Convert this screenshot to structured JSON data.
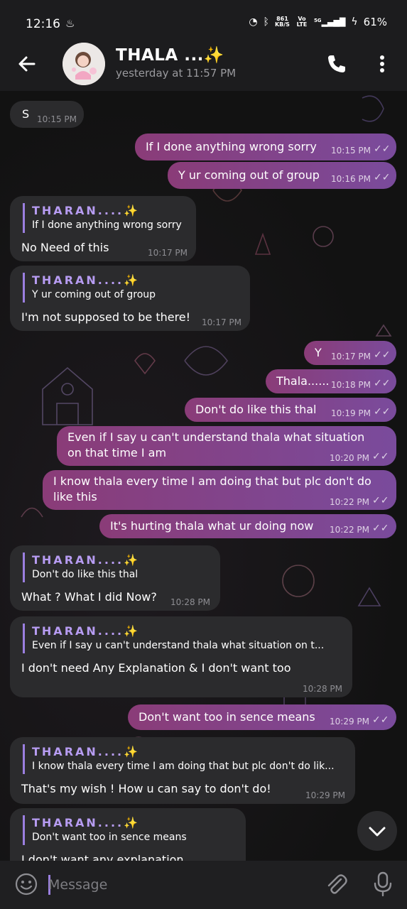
{
  "status_bar": {
    "time": "12:16",
    "net_speed": "861",
    "net_unit": "KB/S",
    "volte": "Vo LTE",
    "signal": "5G",
    "battery": "61%"
  },
  "header": {
    "title": "THALA ...✨",
    "subtitle": "yesterday at 11:57 PM"
  },
  "colors": {
    "incoming": "#2b2b2d",
    "outgoing_start": "#8a3c78",
    "outgoing_end": "#7a4b9c",
    "reply_accent": "#9b7fe0"
  },
  "messages": [
    {
      "text": "S",
      "time": "10:15 PM"
    },
    {
      "text": "If I done anything wrong sorry",
      "time": "10:15 PM"
    },
    {
      "text": "Y ur coming out of group",
      "time": "10:16 PM"
    },
    {
      "reply_name": "THARAN....✨",
      "reply_text": "If I done anything wrong sorry",
      "text": "No Need of this",
      "time": "10:17 PM"
    },
    {
      "reply_name": "THARAN....✨",
      "reply_text": "Y ur coming out of group",
      "text": "I'm not supposed to be there!",
      "time": "10:17 PM"
    },
    {
      "text": "Y",
      "time": "10:17 PM"
    },
    {
      "text": "Thala......",
      "time": "10:18 PM"
    },
    {
      "text": "Don't do like this thal",
      "time": "10:19 PM"
    },
    {
      "text_line1": "Even if I say u can't understand thala what situation",
      "text_line2": "on that time I am",
      "time": "10:20 PM"
    },
    {
      "text_line1": "I know thala every time I am doing that but plc don't do",
      "text_line2": "like this",
      "time": "10:22 PM"
    },
    {
      "text": "It's hurting thala what ur doing now",
      "time": "10:22 PM"
    },
    {
      "reply_name": "THARAN....✨",
      "reply_text": "Don't do like this thal",
      "text": "What ? What I did Now?",
      "time": "10:28 PM"
    },
    {
      "reply_name": "THARAN....✨",
      "reply_text": "Even if I say u can't understand thala what situation on t...",
      "text": "I don't need Any Explanation & I don't want too",
      "time": "10:28 PM"
    },
    {
      "text": "Don't want too in sence means",
      "time": "10:29 PM"
    },
    {
      "reply_name": "THARAN....✨",
      "reply_text": "I know thala every time I am doing that but plc don't do lik...",
      "text": "That's my wish  ! How u can say to don't do!",
      "time": "10:29 PM"
    },
    {
      "reply_name": "THARAN....✨",
      "reply_text": "Don't want too in sence means",
      "text": "I don't want any explanation"
    }
  ],
  "input": {
    "placeholder": "Message"
  }
}
